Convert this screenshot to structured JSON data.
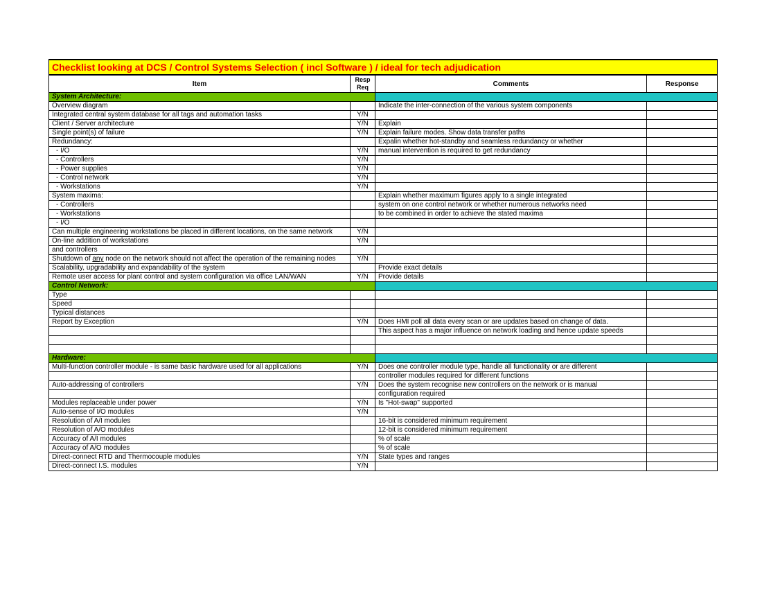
{
  "title": "Checklist looking at DCS / Control Systems Selection ( incl Software ) / ideal for tech adjudication",
  "headers": {
    "item": "Item",
    "resp": "Resp Req",
    "comments": "Comments",
    "response": "Response"
  },
  "sections": [
    {
      "name": "System Architecture:",
      "rows": [
        {
          "item": "Overview diagram",
          "resp": "",
          "comment": "Indicate the inter-connection of the various system components"
        },
        {
          "item": "Integrated central system database for all tags and automation tasks",
          "resp": "Y/N",
          "comment": ""
        },
        {
          "item": "Client / Server architecture",
          "resp": "Y/N",
          "comment": "Explain"
        },
        {
          "item": "Single point(s) of failure",
          "resp": "Y/N",
          "comment": "Explain failure modes. Show data transfer paths"
        },
        {
          "item": "Redundancy:",
          "resp": "",
          "comment": "Expalin whether hot-standby and seamless redundancy or whether"
        },
        {
          "item": " - I/O",
          "ind": true,
          "resp": "Y/N",
          "comment": "manual intervention is required to get redundancy"
        },
        {
          "item": " - Controllers",
          "ind": true,
          "resp": "Y/N",
          "comment": ""
        },
        {
          "item": " - Power supplies",
          "ind": true,
          "resp": "Y/N",
          "comment": ""
        },
        {
          "item": " - Control network",
          "ind": true,
          "resp": "Y/N",
          "comment": ""
        },
        {
          "item": " - Workstations",
          "ind": true,
          "resp": "Y/N",
          "comment": ""
        },
        {
          "item": "System maxima:",
          "resp": "",
          "comment": "Explain whether maximum figures apply to a single integrated"
        },
        {
          "item": " - Controllers",
          "ind": true,
          "resp": "",
          "comment": "system on one control network or whether numerous networks need"
        },
        {
          "item": " - Workstations",
          "ind": true,
          "resp": "",
          "comment": "to be combined in order to achieve the stated maxima"
        },
        {
          "item": " - I/O",
          "ind": true,
          "resp": "",
          "comment": ""
        },
        {
          "item": "Can multiple engineering workstations be placed in different locations, on the same network",
          "resp": "Y/N",
          "comment": ""
        },
        {
          "item": "On-line addition of workstations",
          "resp": "Y/N",
          "comment": ""
        },
        {
          "item": " and controllers",
          "resp": "",
          "comment": ""
        },
        {
          "item_html": "Shutdown of <span class=\"u\">any</span> node on the network should not affect the operation of the remaining nodes",
          "resp": "Y/N",
          "comment": ""
        },
        {
          "item": "Scalability, upgradability and expandability of the system",
          "resp": "",
          "comment": "Provide exact details"
        },
        {
          "item": "Remote user access for plant control and system configuration via office LAN/WAN",
          "resp": "Y/N",
          "comment": "Provide details"
        }
      ]
    },
    {
      "name": "Control Network:",
      "rows": [
        {
          "item": "Type",
          "resp": "",
          "comment": ""
        },
        {
          "item": "Speed",
          "resp": "",
          "comment": ""
        },
        {
          "item": "Typical distances",
          "resp": "",
          "comment": ""
        },
        {
          "item": "Report by Exception",
          "resp": "Y/N",
          "comment": "Does HMI poll all data every scan or are updates based on change of data."
        },
        {
          "item": "",
          "resp": "",
          "comment": "This aspect has a major influence on network loading and hence update speeds"
        },
        {
          "item": "",
          "resp": "",
          "comment": ""
        },
        {
          "item": "",
          "resp": "",
          "comment": ""
        }
      ]
    },
    {
      "name": "Hardware:",
      "rows": [
        {
          "item": "Multi-function controller module - is same basic hardware used for all applications",
          "resp": "Y/N",
          "comment": "Does one controller module type, handle all functionality or are different"
        },
        {
          "item": "",
          "resp": "",
          "comment": "controller modules required for different functions"
        },
        {
          "item": "Auto-addressing of controllers",
          "resp": "Y/N",
          "comment": "Does the system recognise new controllers on the network or is manual"
        },
        {
          "item": "",
          "resp": "",
          "comment": "configuration required"
        },
        {
          "item": "Modules replaceable under power",
          "resp": "Y/N",
          "comment": "Is \"Hot-swap\" supported"
        },
        {
          "item": "Auto-sense of I/O modules",
          "resp": "Y/N",
          "comment": ""
        },
        {
          "item": "Resolution of A/I modules",
          "resp": "",
          "comment": "16-bit is considered minimum requirement"
        },
        {
          "item": "Resolution of A/O modules",
          "resp": "",
          "comment": "12-bit is considered minimum requirement"
        },
        {
          "item": "Accuracy of A/I modules",
          "resp": "",
          "comment": "% of scale"
        },
        {
          "item": "Accuracy of A/O modules",
          "resp": "",
          "comment": "% of scale"
        },
        {
          "item": "Direct-connect RTD and Thermocouple modules",
          "resp": "Y/N",
          "comment": "State types and ranges"
        },
        {
          "item": "Direct-connect I.S. modules",
          "resp": "Y/N",
          "comment": ""
        }
      ]
    }
  ]
}
